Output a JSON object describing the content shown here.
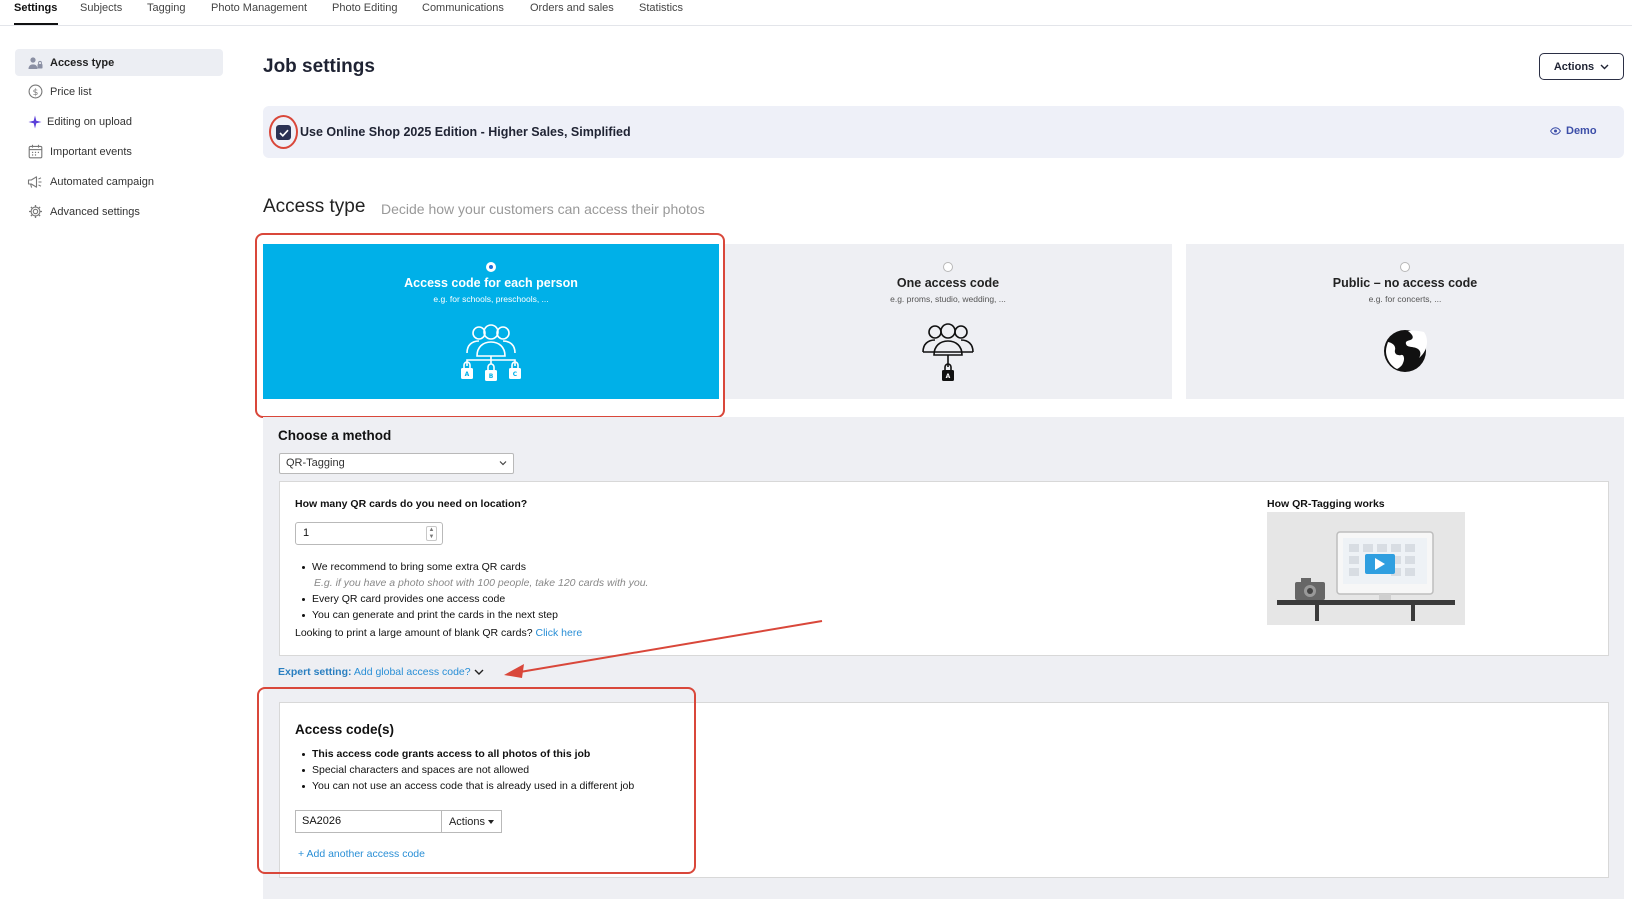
{
  "topnav": {
    "tabs": [
      {
        "label": "Settings"
      },
      {
        "label": "Subjects"
      },
      {
        "label": "Tagging"
      },
      {
        "label": "Photo Management"
      },
      {
        "label": "Photo Editing"
      },
      {
        "label": "Communications"
      },
      {
        "label": "Orders and sales"
      },
      {
        "label": "Statistics"
      }
    ],
    "active": "Settings"
  },
  "sidebar": {
    "items": [
      {
        "label": "Access type",
        "icon": "user-lock-icon",
        "active": true
      },
      {
        "label": "Price list",
        "icon": "dollar-circle-icon"
      },
      {
        "label": "Editing on upload",
        "icon": "sparkle-icon"
      },
      {
        "label": "Important events",
        "icon": "calendar-icon"
      },
      {
        "label": "Automated campaign",
        "icon": "megaphone-icon"
      },
      {
        "label": "Advanced settings",
        "icon": "gear-icon"
      }
    ]
  },
  "header": {
    "title": "Job settings",
    "actions_label": "Actions"
  },
  "banner": {
    "checkbox_checked": true,
    "label": "Use Online Shop 2025 Edition - Higher Sales, Simplified",
    "demo_label": "Demo"
  },
  "access_type": {
    "heading": "Access type",
    "subheading": "Decide how your customers can access their photos",
    "options": [
      {
        "title": "Access code for each person",
        "subtitle": "e.g. for schools, preschools, ...",
        "selected": true,
        "icon": "group-multi-lock-icon"
      },
      {
        "title": "One access code",
        "subtitle": "e.g. proms, studio, wedding, ...",
        "selected": false,
        "icon": "group-single-lock-icon"
      },
      {
        "title": "Public – no access code",
        "subtitle": "e.g. for concerts, ...",
        "selected": false,
        "icon": "globe-icon"
      }
    ]
  },
  "method": {
    "heading": "Choose a method",
    "selected": "QR-Tagging",
    "question": "How many QR cards do you need on location?",
    "quantity": "1",
    "bullets": [
      "We recommend to bring some extra QR cards",
      "Every QR card provides one access code",
      "You can generate and print the cards in the next step"
    ],
    "bullet_note": "E.g. if you have a photo shoot with 100 people, take 120 cards with you.",
    "blank_question": "Looking to print a large amount of blank QR cards?",
    "blank_link": "Click here",
    "video_title": "How QR-Tagging works"
  },
  "expert": {
    "prefix": "Expert setting:",
    "link": "Add global access code?"
  },
  "access_codes": {
    "heading": "Access code(s)",
    "bullets": [
      "This access code grants access to all photos of this job",
      "Special characters and spaces are not allowed",
      "You can not use an access code that is already used in a different job"
    ],
    "code_value": "SA2026",
    "actions_label": "Actions",
    "add_label": "+ Add another access code"
  },
  "colors": {
    "selected_card": "#00b0e8",
    "annotation_red": "#d9473a",
    "link_blue": "#2a8fd6",
    "dark_navy": "#2b3153"
  }
}
